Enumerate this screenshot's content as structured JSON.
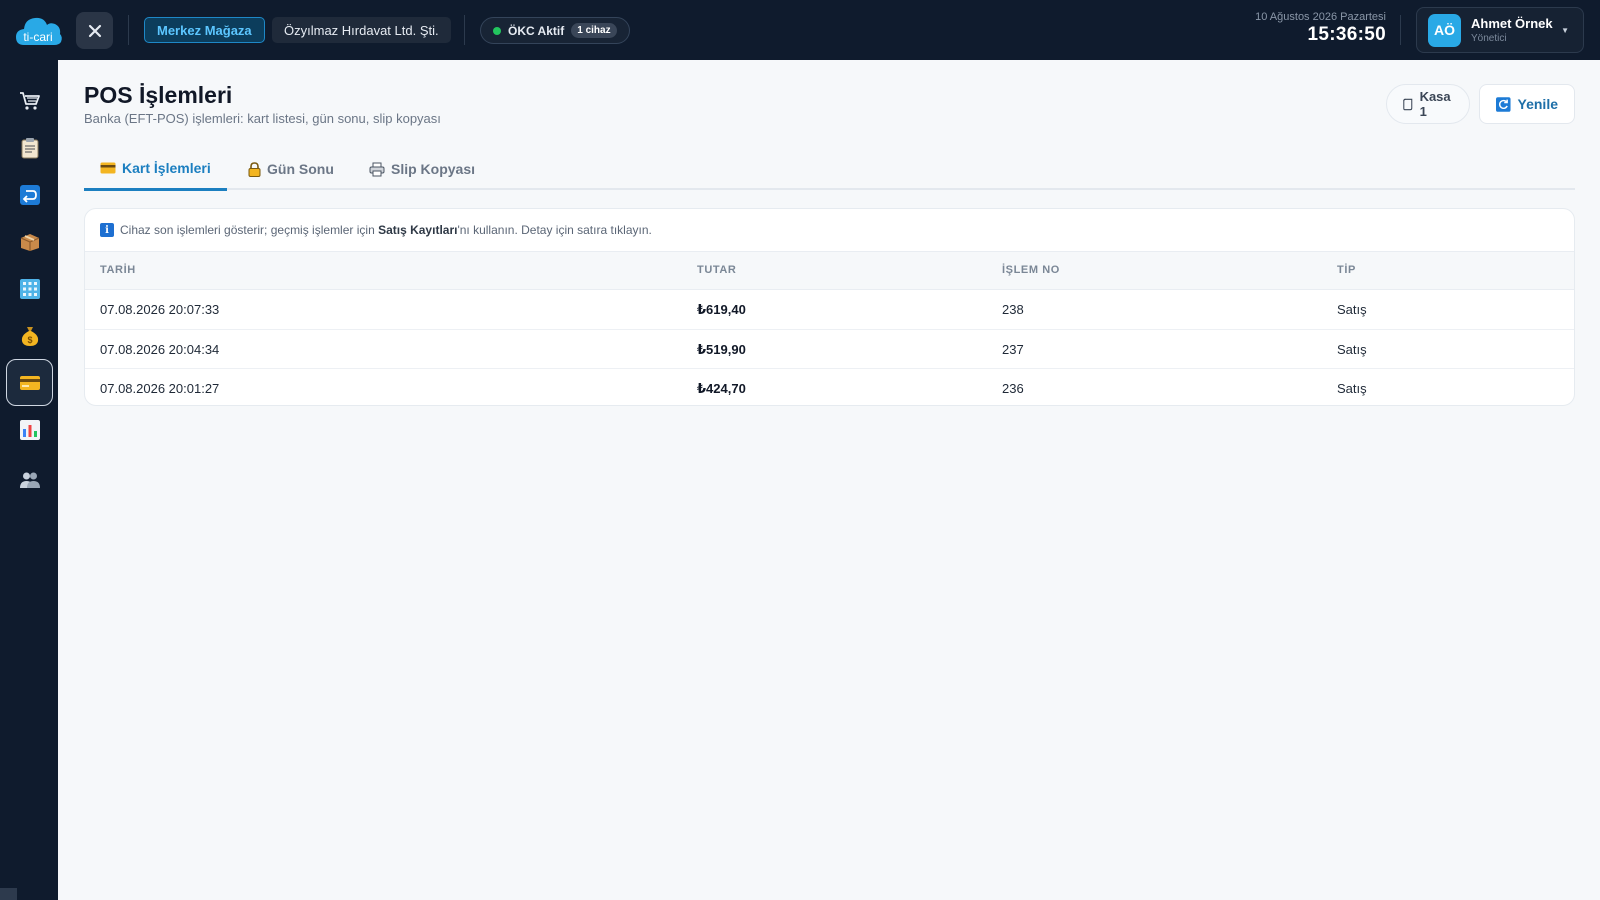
{
  "brand": {
    "logo_text": "ti-cari",
    "accent": "#29a9e6"
  },
  "header": {
    "store_label": "Merkez Mağaza",
    "company_label": "Özyılmaz Hırdavat Ltd. Şti.",
    "okc_label": "ÖKC Aktif",
    "okc_devices": "1 cihaz",
    "date": "10 Ağustos 2026 Pazartesi",
    "time": "15:36:50",
    "user": {
      "initials": "AÖ",
      "name": "Ahmet Örnek",
      "role": "Yönetici"
    }
  },
  "sidebar": {
    "items": [
      {
        "icon": "cart-icon"
      },
      {
        "icon": "clipboard-icon"
      },
      {
        "icon": "return-icon"
      },
      {
        "icon": "box-icon"
      },
      {
        "icon": "grid-icon"
      },
      {
        "icon": "money-bag-icon"
      },
      {
        "icon": "credit-card-icon",
        "active": true
      },
      {
        "icon": "bar-chart-icon"
      },
      {
        "icon": "users-icon"
      }
    ]
  },
  "page": {
    "title": "POS İşlemleri",
    "subtitle": "Banka (EFT-POS) işlemleri: kart listesi, gün sonu, slip kopyası",
    "kasa_label": "Kasa 1",
    "refresh_label": "Yenile"
  },
  "tabs": [
    {
      "label": "Kart İşlemleri",
      "icon": "card-icon",
      "active": true
    },
    {
      "label": "Gün Sonu",
      "icon": "lock-icon",
      "active": false
    },
    {
      "label": "Slip Kopyası",
      "icon": "printer-icon",
      "active": false
    }
  ],
  "info": {
    "before": "Cihaz son işlemleri gösterir; geçmiş işlemler için ",
    "bold": "Satış Kayıtları",
    "after": "'nı kullanın. Detay için satıra tıklayın."
  },
  "table": {
    "columns": [
      "TARİH",
      "TUTAR",
      "İŞLEM NO",
      "TİP"
    ],
    "rows": [
      {
        "date": "07.08.2026 20:07:33",
        "amount": "₺619,40",
        "no": "238",
        "type": "Satış"
      },
      {
        "date": "07.08.2026 20:04:34",
        "amount": "₺519,90",
        "no": "237",
        "type": "Satış"
      },
      {
        "date": "07.08.2026 20:01:27",
        "amount": "₺424,70",
        "no": "236",
        "type": "Satış"
      }
    ]
  }
}
